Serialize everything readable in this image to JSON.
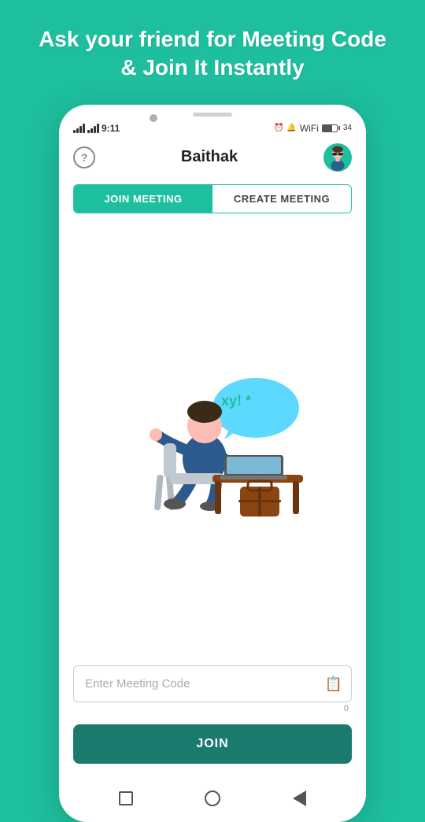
{
  "header": {
    "title": "Ask your friend for Meeting Code & Join It Instantly"
  },
  "statusBar": {
    "time": "9:11",
    "batteryPercent": "34"
  },
  "appBar": {
    "appTitle": "Baithak",
    "helpLabel": "?"
  },
  "tabs": [
    {
      "id": "join",
      "label": "JOIN MEETING",
      "active": true
    },
    {
      "id": "create",
      "label": "CREATE MEETING",
      "active": false
    }
  ],
  "input": {
    "placeholder": "Enter Meeting Code",
    "charCount": "0"
  },
  "joinButton": {
    "label": "JOIN"
  },
  "bottomNav": {
    "icons": [
      "square",
      "circle",
      "back"
    ]
  }
}
